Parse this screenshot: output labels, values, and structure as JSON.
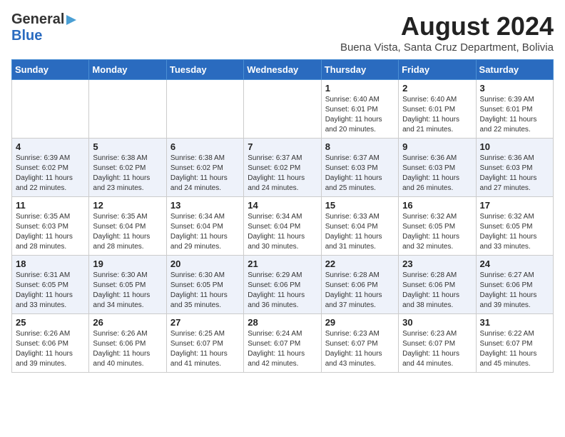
{
  "header": {
    "logo_line1": "General",
    "logo_line2": "Blue",
    "title": "August 2024",
    "subtitle": "Buena Vista, Santa Cruz Department, Bolivia"
  },
  "days_of_week": [
    "Sunday",
    "Monday",
    "Tuesday",
    "Wednesday",
    "Thursday",
    "Friday",
    "Saturday"
  ],
  "weeks": [
    [
      {
        "day": "",
        "info": ""
      },
      {
        "day": "",
        "info": ""
      },
      {
        "day": "",
        "info": ""
      },
      {
        "day": "",
        "info": ""
      },
      {
        "day": "1",
        "info": "Sunrise: 6:40 AM\nSunset: 6:01 PM\nDaylight: 11 hours\nand 20 minutes."
      },
      {
        "day": "2",
        "info": "Sunrise: 6:40 AM\nSunset: 6:01 PM\nDaylight: 11 hours\nand 21 minutes."
      },
      {
        "day": "3",
        "info": "Sunrise: 6:39 AM\nSunset: 6:01 PM\nDaylight: 11 hours\nand 22 minutes."
      }
    ],
    [
      {
        "day": "4",
        "info": "Sunrise: 6:39 AM\nSunset: 6:02 PM\nDaylight: 11 hours\nand 22 minutes."
      },
      {
        "day": "5",
        "info": "Sunrise: 6:38 AM\nSunset: 6:02 PM\nDaylight: 11 hours\nand 23 minutes."
      },
      {
        "day": "6",
        "info": "Sunrise: 6:38 AM\nSunset: 6:02 PM\nDaylight: 11 hours\nand 24 minutes."
      },
      {
        "day": "7",
        "info": "Sunrise: 6:37 AM\nSunset: 6:02 PM\nDaylight: 11 hours\nand 24 minutes."
      },
      {
        "day": "8",
        "info": "Sunrise: 6:37 AM\nSunset: 6:03 PM\nDaylight: 11 hours\nand 25 minutes."
      },
      {
        "day": "9",
        "info": "Sunrise: 6:36 AM\nSunset: 6:03 PM\nDaylight: 11 hours\nand 26 minutes."
      },
      {
        "day": "10",
        "info": "Sunrise: 6:36 AM\nSunset: 6:03 PM\nDaylight: 11 hours\nand 27 minutes."
      }
    ],
    [
      {
        "day": "11",
        "info": "Sunrise: 6:35 AM\nSunset: 6:03 PM\nDaylight: 11 hours\nand 28 minutes."
      },
      {
        "day": "12",
        "info": "Sunrise: 6:35 AM\nSunset: 6:04 PM\nDaylight: 11 hours\nand 28 minutes."
      },
      {
        "day": "13",
        "info": "Sunrise: 6:34 AM\nSunset: 6:04 PM\nDaylight: 11 hours\nand 29 minutes."
      },
      {
        "day": "14",
        "info": "Sunrise: 6:34 AM\nSunset: 6:04 PM\nDaylight: 11 hours\nand 30 minutes."
      },
      {
        "day": "15",
        "info": "Sunrise: 6:33 AM\nSunset: 6:04 PM\nDaylight: 11 hours\nand 31 minutes."
      },
      {
        "day": "16",
        "info": "Sunrise: 6:32 AM\nSunset: 6:05 PM\nDaylight: 11 hours\nand 32 minutes."
      },
      {
        "day": "17",
        "info": "Sunrise: 6:32 AM\nSunset: 6:05 PM\nDaylight: 11 hours\nand 33 minutes."
      }
    ],
    [
      {
        "day": "18",
        "info": "Sunrise: 6:31 AM\nSunset: 6:05 PM\nDaylight: 11 hours\nand 33 minutes."
      },
      {
        "day": "19",
        "info": "Sunrise: 6:30 AM\nSunset: 6:05 PM\nDaylight: 11 hours\nand 34 minutes."
      },
      {
        "day": "20",
        "info": "Sunrise: 6:30 AM\nSunset: 6:05 PM\nDaylight: 11 hours\nand 35 minutes."
      },
      {
        "day": "21",
        "info": "Sunrise: 6:29 AM\nSunset: 6:06 PM\nDaylight: 11 hours\nand 36 minutes."
      },
      {
        "day": "22",
        "info": "Sunrise: 6:28 AM\nSunset: 6:06 PM\nDaylight: 11 hours\nand 37 minutes."
      },
      {
        "day": "23",
        "info": "Sunrise: 6:28 AM\nSunset: 6:06 PM\nDaylight: 11 hours\nand 38 minutes."
      },
      {
        "day": "24",
        "info": "Sunrise: 6:27 AM\nSunset: 6:06 PM\nDaylight: 11 hours\nand 39 minutes."
      }
    ],
    [
      {
        "day": "25",
        "info": "Sunrise: 6:26 AM\nSunset: 6:06 PM\nDaylight: 11 hours\nand 39 minutes."
      },
      {
        "day": "26",
        "info": "Sunrise: 6:26 AM\nSunset: 6:06 PM\nDaylight: 11 hours\nand 40 minutes."
      },
      {
        "day": "27",
        "info": "Sunrise: 6:25 AM\nSunset: 6:07 PM\nDaylight: 11 hours\nand 41 minutes."
      },
      {
        "day": "28",
        "info": "Sunrise: 6:24 AM\nSunset: 6:07 PM\nDaylight: 11 hours\nand 42 minutes."
      },
      {
        "day": "29",
        "info": "Sunrise: 6:23 AM\nSunset: 6:07 PM\nDaylight: 11 hours\nand 43 minutes."
      },
      {
        "day": "30",
        "info": "Sunrise: 6:23 AM\nSunset: 6:07 PM\nDaylight: 11 hours\nand 44 minutes."
      },
      {
        "day": "31",
        "info": "Sunrise: 6:22 AM\nSunset: 6:07 PM\nDaylight: 11 hours\nand 45 minutes."
      }
    ]
  ]
}
